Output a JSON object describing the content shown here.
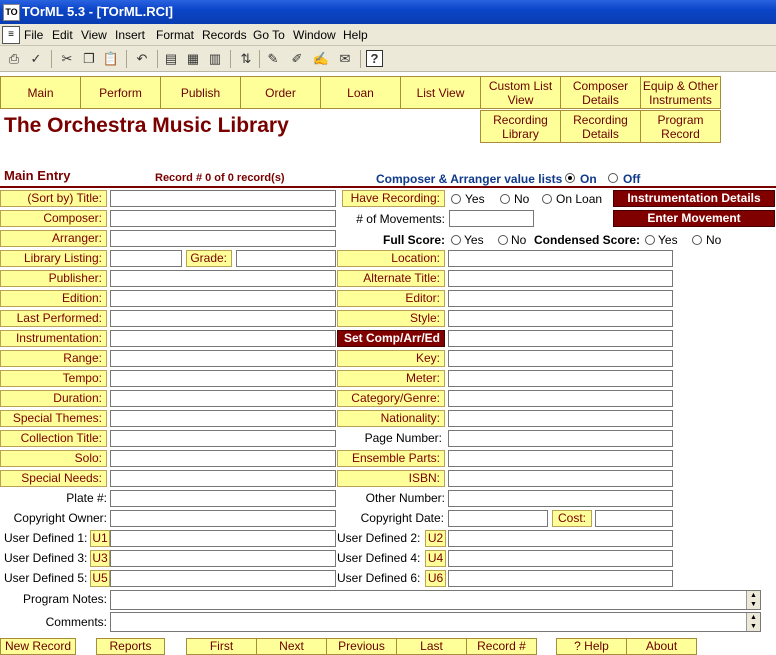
{
  "window": {
    "title": "TOrML 5.3 - [TOrML.RCI]",
    "app_icon": "TO"
  },
  "menu": [
    "File",
    "Edit",
    "View",
    "Insert",
    "Format",
    "Records",
    "Go To",
    "Window",
    "Help"
  ],
  "nav_row1": [
    "Main",
    "Perform",
    "Publish",
    "Order",
    "Loan",
    "List View",
    "Custom List View",
    "Composer Details",
    "Equip & Other Instruments"
  ],
  "nav_row2": [
    "Recording Library",
    "Recording Details",
    "Program Record"
  ],
  "app_title": "The Orchestra Music Library",
  "main_entry": "Main Entry",
  "record_info": "Record # 0 of 0 record(s)",
  "value_lists": {
    "label": "Composer & Arranger value lists",
    "on": "On",
    "off": "Off"
  },
  "left_labels": {
    "title": "(Sort by) Title:",
    "composer": "Composer:",
    "arranger": "Arranger:",
    "library_listing": "Library Listing:",
    "grade": "Grade:",
    "publisher": "Publisher:",
    "edition": "Edition:",
    "last_performed": "Last Performed:",
    "instrumentation": "Instrumentation:",
    "range": "Range:",
    "tempo": "Tempo:",
    "duration": "Duration:",
    "special_themes": "Special Themes:",
    "collection_title": "Collection Title:",
    "solo": "Solo:",
    "special_needs": "Special Needs:",
    "plate": "Plate #:",
    "copyright_owner": "Copyright Owner:"
  },
  "right_labels": {
    "have_recording": "Have Recording:",
    "movements": "# of Movements:",
    "full_score": "Full Score:",
    "condensed_score": "Condensed Score:",
    "location": "Location:",
    "alternate_title": "Alternate Title:",
    "editor": "Editor:",
    "style": "Style:",
    "key": "Key:",
    "meter": "Meter:",
    "category": "Category/Genre:",
    "nationality": "Nationality:",
    "page_number": "Page Number:",
    "ensemble_parts": "Ensemble Parts:",
    "isbn": "ISBN:",
    "other_number": "Other Number:",
    "copyright_date": "Copyright Date:",
    "cost": "Cost:"
  },
  "recording_options": [
    "Yes",
    "No",
    "On Loan"
  ],
  "yes_no": [
    "Yes",
    "No"
  ],
  "set_comp": "Set Comp/Arr/Ed",
  "instrumentation_details": "Instrumentation Details",
  "enter_movement": "Enter Movement Information",
  "user_defined": {
    "ud1": "User Defined 1:",
    "ud2": "User Defined 2:",
    "ud3": "User Defined 3:",
    "ud4": "User Defined 4:",
    "ud5": "User Defined 5:",
    "ud6": "User Defined 6:",
    "u1": "U1",
    "u2": "U2",
    "u3": "U3",
    "u4": "U4",
    "u5": "U5",
    "u6": "U6"
  },
  "notes": {
    "program_notes": "Program Notes:",
    "comments": "Comments:"
  },
  "bottom_buttons": [
    "New Record",
    "Reports",
    "First",
    "Next",
    "Previous",
    "Last",
    "Record #",
    "? Help",
    "About"
  ]
}
